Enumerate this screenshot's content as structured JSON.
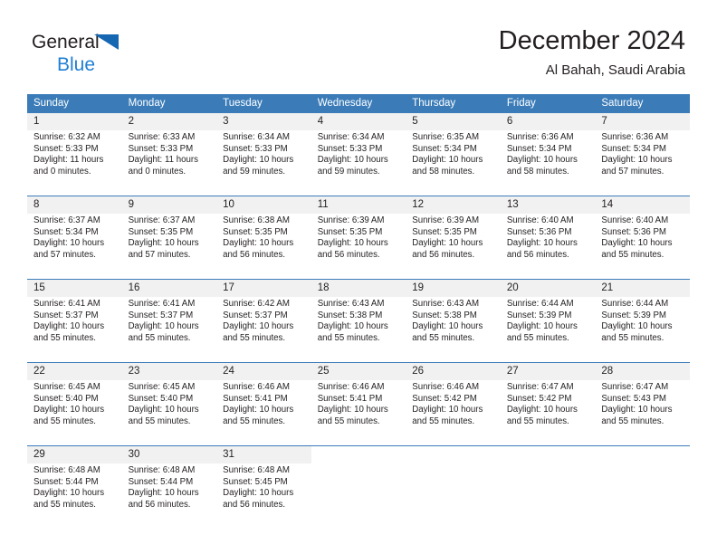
{
  "brand": {
    "word1": "General",
    "word2": "Blue",
    "accent_color": "#1f7fd4",
    "triangle_color": "#1567b2"
  },
  "header": {
    "title": "December 2024",
    "subtitle": "Al Bahah, Saudi Arabia",
    "header_bg_color": "#3b7cb8",
    "daynum_bg_color": "#f1f1f1"
  },
  "calendar": {
    "weekday_headers": [
      "Sunday",
      "Monday",
      "Tuesday",
      "Wednesday",
      "Thursday",
      "Friday",
      "Saturday"
    ],
    "weeks": [
      [
        {
          "day": "1",
          "sunrise": "Sunrise: 6:32 AM",
          "sunset": "Sunset: 5:33 PM",
          "daylight1": "Daylight: 11 hours",
          "daylight2": "and 0 minutes."
        },
        {
          "day": "2",
          "sunrise": "Sunrise: 6:33 AM",
          "sunset": "Sunset: 5:33 PM",
          "daylight1": "Daylight: 11 hours",
          "daylight2": "and 0 minutes."
        },
        {
          "day": "3",
          "sunrise": "Sunrise: 6:34 AM",
          "sunset": "Sunset: 5:33 PM",
          "daylight1": "Daylight: 10 hours",
          "daylight2": "and 59 minutes."
        },
        {
          "day": "4",
          "sunrise": "Sunrise: 6:34 AM",
          "sunset": "Sunset: 5:33 PM",
          "daylight1": "Daylight: 10 hours",
          "daylight2": "and 59 minutes."
        },
        {
          "day": "5",
          "sunrise": "Sunrise: 6:35 AM",
          "sunset": "Sunset: 5:34 PM",
          "daylight1": "Daylight: 10 hours",
          "daylight2": "and 58 minutes."
        },
        {
          "day": "6",
          "sunrise": "Sunrise: 6:36 AM",
          "sunset": "Sunset: 5:34 PM",
          "daylight1": "Daylight: 10 hours",
          "daylight2": "and 58 minutes."
        },
        {
          "day": "7",
          "sunrise": "Sunrise: 6:36 AM",
          "sunset": "Sunset: 5:34 PM",
          "daylight1": "Daylight: 10 hours",
          "daylight2": "and 57 minutes."
        }
      ],
      [
        {
          "day": "8",
          "sunrise": "Sunrise: 6:37 AM",
          "sunset": "Sunset: 5:34 PM",
          "daylight1": "Daylight: 10 hours",
          "daylight2": "and 57 minutes."
        },
        {
          "day": "9",
          "sunrise": "Sunrise: 6:37 AM",
          "sunset": "Sunset: 5:35 PM",
          "daylight1": "Daylight: 10 hours",
          "daylight2": "and 57 minutes."
        },
        {
          "day": "10",
          "sunrise": "Sunrise: 6:38 AM",
          "sunset": "Sunset: 5:35 PM",
          "daylight1": "Daylight: 10 hours",
          "daylight2": "and 56 minutes."
        },
        {
          "day": "11",
          "sunrise": "Sunrise: 6:39 AM",
          "sunset": "Sunset: 5:35 PM",
          "daylight1": "Daylight: 10 hours",
          "daylight2": "and 56 minutes."
        },
        {
          "day": "12",
          "sunrise": "Sunrise: 6:39 AM",
          "sunset": "Sunset: 5:35 PM",
          "daylight1": "Daylight: 10 hours",
          "daylight2": "and 56 minutes."
        },
        {
          "day": "13",
          "sunrise": "Sunrise: 6:40 AM",
          "sunset": "Sunset: 5:36 PM",
          "daylight1": "Daylight: 10 hours",
          "daylight2": "and 56 minutes."
        },
        {
          "day": "14",
          "sunrise": "Sunrise: 6:40 AM",
          "sunset": "Sunset: 5:36 PM",
          "daylight1": "Daylight: 10 hours",
          "daylight2": "and 55 minutes."
        }
      ],
      [
        {
          "day": "15",
          "sunrise": "Sunrise: 6:41 AM",
          "sunset": "Sunset: 5:37 PM",
          "daylight1": "Daylight: 10 hours",
          "daylight2": "and 55 minutes."
        },
        {
          "day": "16",
          "sunrise": "Sunrise: 6:41 AM",
          "sunset": "Sunset: 5:37 PM",
          "daylight1": "Daylight: 10 hours",
          "daylight2": "and 55 minutes."
        },
        {
          "day": "17",
          "sunrise": "Sunrise: 6:42 AM",
          "sunset": "Sunset: 5:37 PM",
          "daylight1": "Daylight: 10 hours",
          "daylight2": "and 55 minutes."
        },
        {
          "day": "18",
          "sunrise": "Sunrise: 6:43 AM",
          "sunset": "Sunset: 5:38 PM",
          "daylight1": "Daylight: 10 hours",
          "daylight2": "and 55 minutes."
        },
        {
          "day": "19",
          "sunrise": "Sunrise: 6:43 AM",
          "sunset": "Sunset: 5:38 PM",
          "daylight1": "Daylight: 10 hours",
          "daylight2": "and 55 minutes."
        },
        {
          "day": "20",
          "sunrise": "Sunrise: 6:44 AM",
          "sunset": "Sunset: 5:39 PM",
          "daylight1": "Daylight: 10 hours",
          "daylight2": "and 55 minutes."
        },
        {
          "day": "21",
          "sunrise": "Sunrise: 6:44 AM",
          "sunset": "Sunset: 5:39 PM",
          "daylight1": "Daylight: 10 hours",
          "daylight2": "and 55 minutes."
        }
      ],
      [
        {
          "day": "22",
          "sunrise": "Sunrise: 6:45 AM",
          "sunset": "Sunset: 5:40 PM",
          "daylight1": "Daylight: 10 hours",
          "daylight2": "and 55 minutes."
        },
        {
          "day": "23",
          "sunrise": "Sunrise: 6:45 AM",
          "sunset": "Sunset: 5:40 PM",
          "daylight1": "Daylight: 10 hours",
          "daylight2": "and 55 minutes."
        },
        {
          "day": "24",
          "sunrise": "Sunrise: 6:46 AM",
          "sunset": "Sunset: 5:41 PM",
          "daylight1": "Daylight: 10 hours",
          "daylight2": "and 55 minutes."
        },
        {
          "day": "25",
          "sunrise": "Sunrise: 6:46 AM",
          "sunset": "Sunset: 5:41 PM",
          "daylight1": "Daylight: 10 hours",
          "daylight2": "and 55 minutes."
        },
        {
          "day": "26",
          "sunrise": "Sunrise: 6:46 AM",
          "sunset": "Sunset: 5:42 PM",
          "daylight1": "Daylight: 10 hours",
          "daylight2": "and 55 minutes."
        },
        {
          "day": "27",
          "sunrise": "Sunrise: 6:47 AM",
          "sunset": "Sunset: 5:42 PM",
          "daylight1": "Daylight: 10 hours",
          "daylight2": "and 55 minutes."
        },
        {
          "day": "28",
          "sunrise": "Sunrise: 6:47 AM",
          "sunset": "Sunset: 5:43 PM",
          "daylight1": "Daylight: 10 hours",
          "daylight2": "and 55 minutes."
        }
      ],
      [
        {
          "day": "29",
          "sunrise": "Sunrise: 6:48 AM",
          "sunset": "Sunset: 5:44 PM",
          "daylight1": "Daylight: 10 hours",
          "daylight2": "and 55 minutes."
        },
        {
          "day": "30",
          "sunrise": "Sunrise: 6:48 AM",
          "sunset": "Sunset: 5:44 PM",
          "daylight1": "Daylight: 10 hours",
          "daylight2": "and 56 minutes."
        },
        {
          "day": "31",
          "sunrise": "Sunrise: 6:48 AM",
          "sunset": "Sunset: 5:45 PM",
          "daylight1": "Daylight: 10 hours",
          "daylight2": "and 56 minutes."
        },
        null,
        null,
        null,
        null
      ]
    ]
  }
}
